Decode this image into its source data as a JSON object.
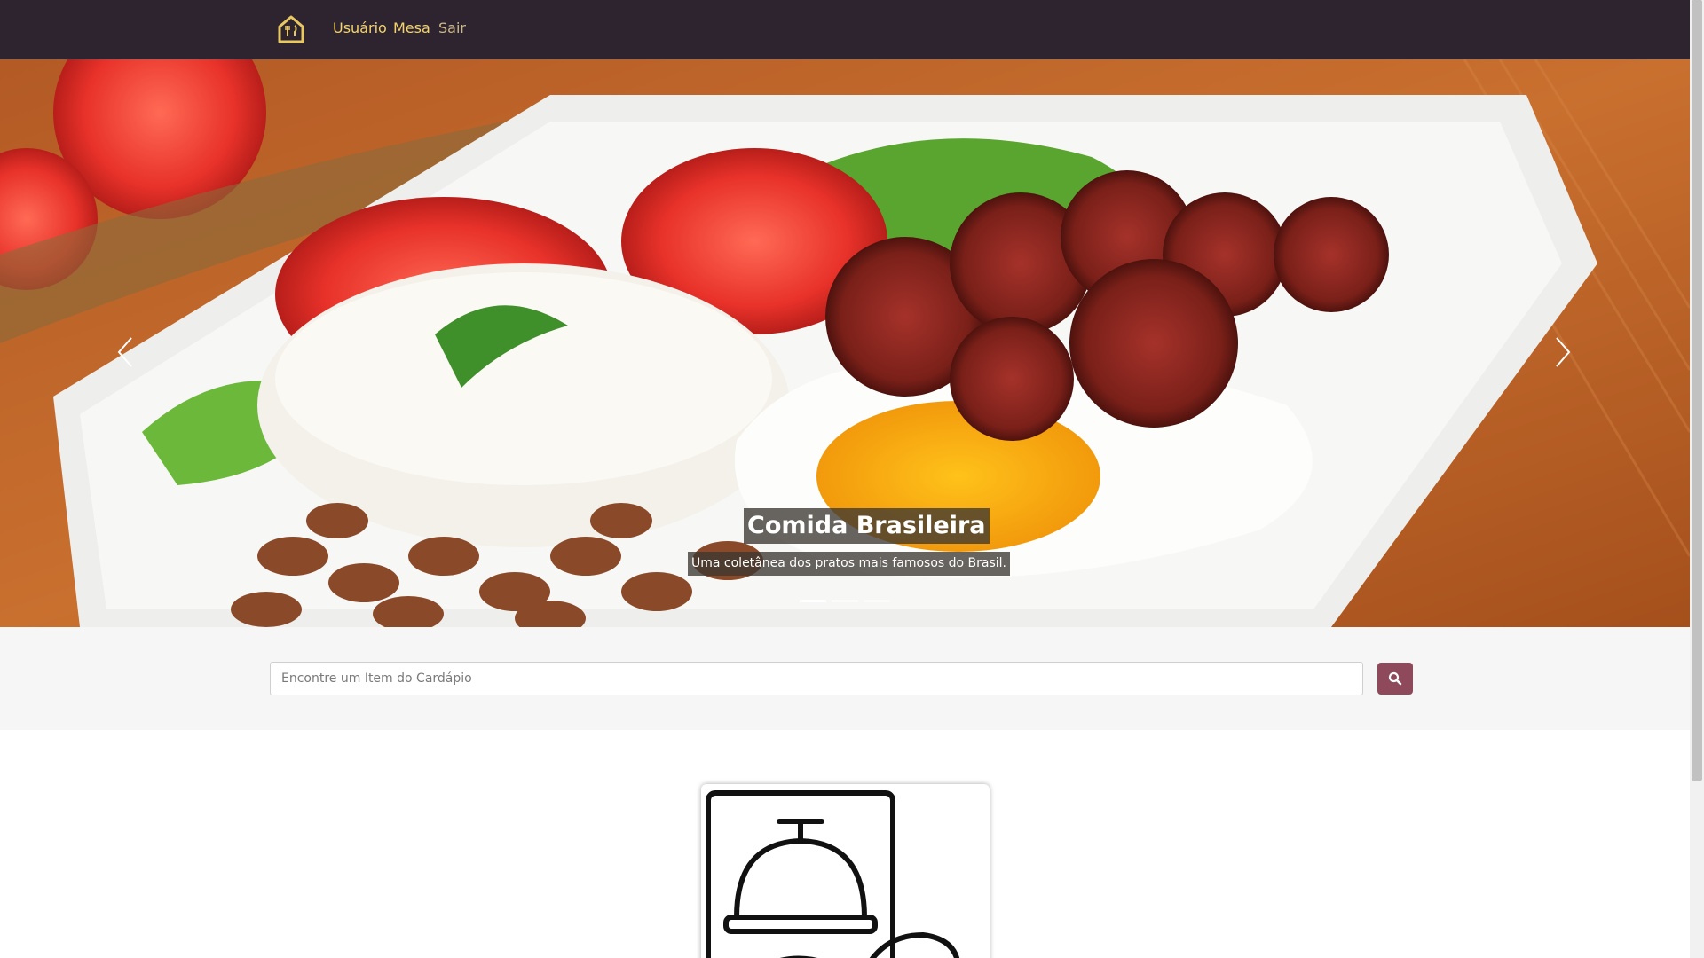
{
  "navbar": {
    "logo_icon": "house-fork-knife-icon",
    "links": [
      "Usuário",
      "Mesa",
      "Sair"
    ],
    "colors": {
      "background": "#2d2430",
      "accent": "#f3d36a"
    }
  },
  "carousel": {
    "title": "Comida Brasileira",
    "subtitle": "Uma coletânea dos pratos mais famosos do Brasil.",
    "slide_count": 3,
    "active_slide": 1
  },
  "search": {
    "placeholder": "Encontre um Item do Cardápio",
    "button_icon": "search-icon",
    "button_color": "#8e4a5b"
  },
  "card": {
    "icon": "service-bell-icon"
  }
}
